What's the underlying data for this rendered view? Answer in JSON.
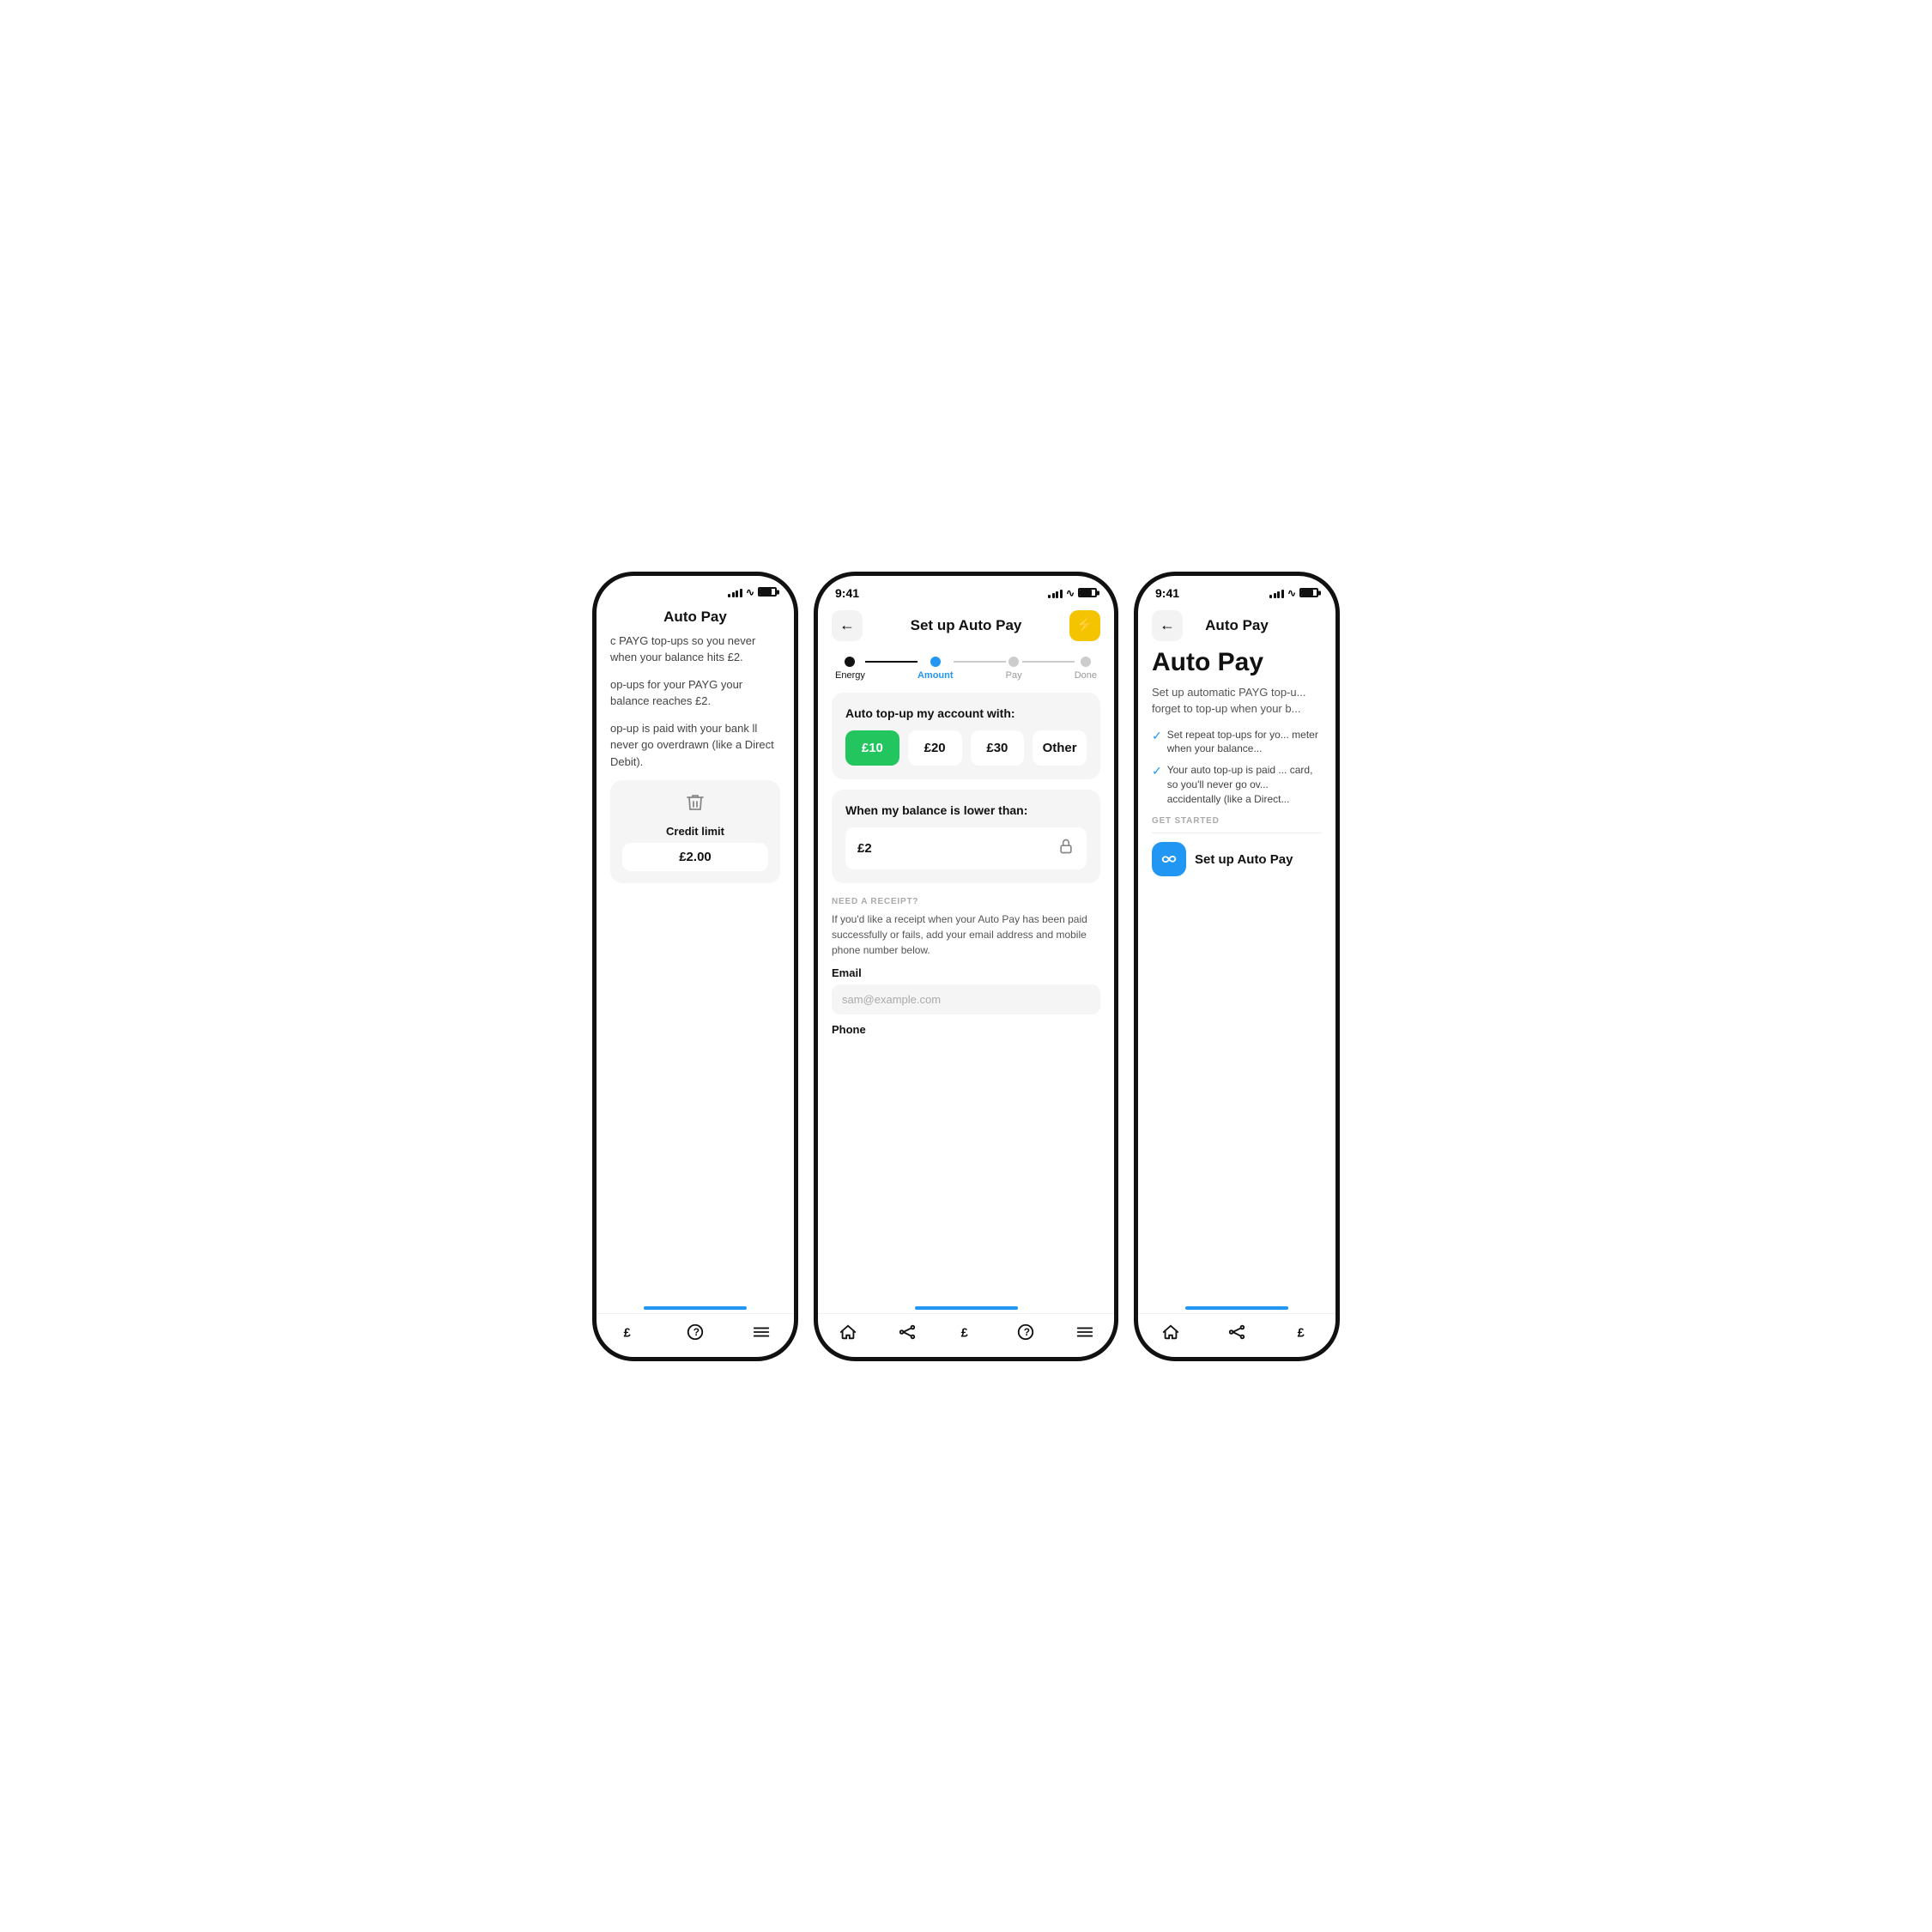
{
  "left_phone": {
    "status_time": "",
    "page_title": "Auto Pay",
    "description1": "c PAYG top-ups so you never when your balance hits £2.",
    "description2": "op-ups for your PAYG your balance reaches £2.",
    "description3": "op-up is paid with your bank ll never go overdrawn (like a Direct Debit).",
    "trash_label": "",
    "credit_limit_label": "Credit limit",
    "credit_limit_value": "£2.00",
    "nav_icons": [
      "pound-icon",
      "help-icon",
      "menu-icon"
    ]
  },
  "center_phone": {
    "status_time": "9:41",
    "header_title": "Set up Auto Pay",
    "back_button": "←",
    "lightning_icon": "⚡",
    "steps": [
      {
        "label": "Energy",
        "state": "done"
      },
      {
        "label": "Amount",
        "state": "active"
      },
      {
        "label": "Pay",
        "state": "upcoming"
      },
      {
        "label": "Done",
        "state": "upcoming"
      }
    ],
    "auto_topup_title": "Auto top-up my account with:",
    "amount_options": [
      {
        "value": "£10",
        "selected": true
      },
      {
        "value": "£20",
        "selected": false
      },
      {
        "value": "£30",
        "selected": false
      },
      {
        "value": "Other",
        "selected": false
      }
    ],
    "balance_title": "When my balance is lower than:",
    "balance_value": "£2",
    "receipt_section_label": "NEED A RECEIPT?",
    "receipt_desc": "If you'd like a receipt when your Auto Pay has been paid successfully or fails, add your email address and mobile phone number below.",
    "email_label": "Email",
    "email_placeholder": "sam@example.com",
    "phone_label": "Phone",
    "nav_icons": [
      "home-icon",
      "flow-icon",
      "pound-icon",
      "help-icon",
      "menu-icon"
    ]
  },
  "right_phone": {
    "status_time": "9:41",
    "header_back": "←",
    "header_title": "Auto Pay",
    "big_title": "Auto Pay",
    "description": "Set up automatic PAYG top-u... forget to top-up when your b...",
    "checklist": [
      "Set repeat top-ups for yo... meter when your balance...",
      "Your auto top-up is paid ... card, so you'll never go ov... accidentally (like a Direct..."
    ],
    "get_started_label": "GET STARTED",
    "setup_btn_label": "Set up Auto Pay",
    "infinity_icon": "∞",
    "nav_icons": [
      "home-icon",
      "flow-icon",
      "pound-icon"
    ]
  },
  "colors": {
    "active_step": "#2196F3",
    "selected_amount": "#22c55e",
    "accent_blue": "#2196F3",
    "yellow": "#f5c400",
    "light_bg": "#f5f5f5",
    "border": "#111"
  }
}
